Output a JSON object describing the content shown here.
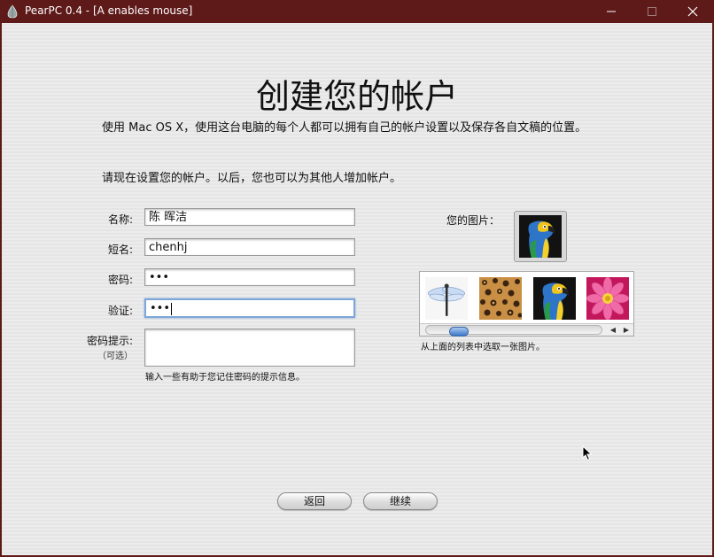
{
  "window": {
    "title": "PearPC 0.4 - [A enables mouse]",
    "controls": {
      "minimize": "minimize",
      "maximize": "maximize",
      "close": "close"
    }
  },
  "page": {
    "heading": "创建您的帐户",
    "description": "使用 Mac OS X，使用这台电脑的每个人都可以拥有自己的帐户设置以及保存各自文稿的位置。",
    "instruction": "请现在设置您的帐户。以后，您也可以为其他人增加帐户。"
  },
  "form": {
    "name_label": "名称:",
    "name_value": "陈 晖洁",
    "short_name_label": "短名:",
    "short_name_value": "chenhj",
    "password_label": "密码:",
    "password_value": "•••",
    "verify_label": "验证:",
    "verify_value": "•••",
    "hint_label": "密码提示:",
    "hint_optional": "（可选）",
    "hint_value": "",
    "hint_help": "输入一些有助于您记住密码的提示信息。"
  },
  "picture": {
    "label": "您的图片：",
    "selected": "parrot",
    "options": [
      "dragonfly",
      "leopard",
      "parrot",
      "flower"
    ],
    "help": "从上面的列表中选取一张图片。"
  },
  "buttons": {
    "back": "返回",
    "continue": "继续"
  },
  "colors": {
    "titlebar": "#5e1919",
    "focus_ring": "#7fa6d9",
    "scroll_thumb": "#3e78c8"
  }
}
